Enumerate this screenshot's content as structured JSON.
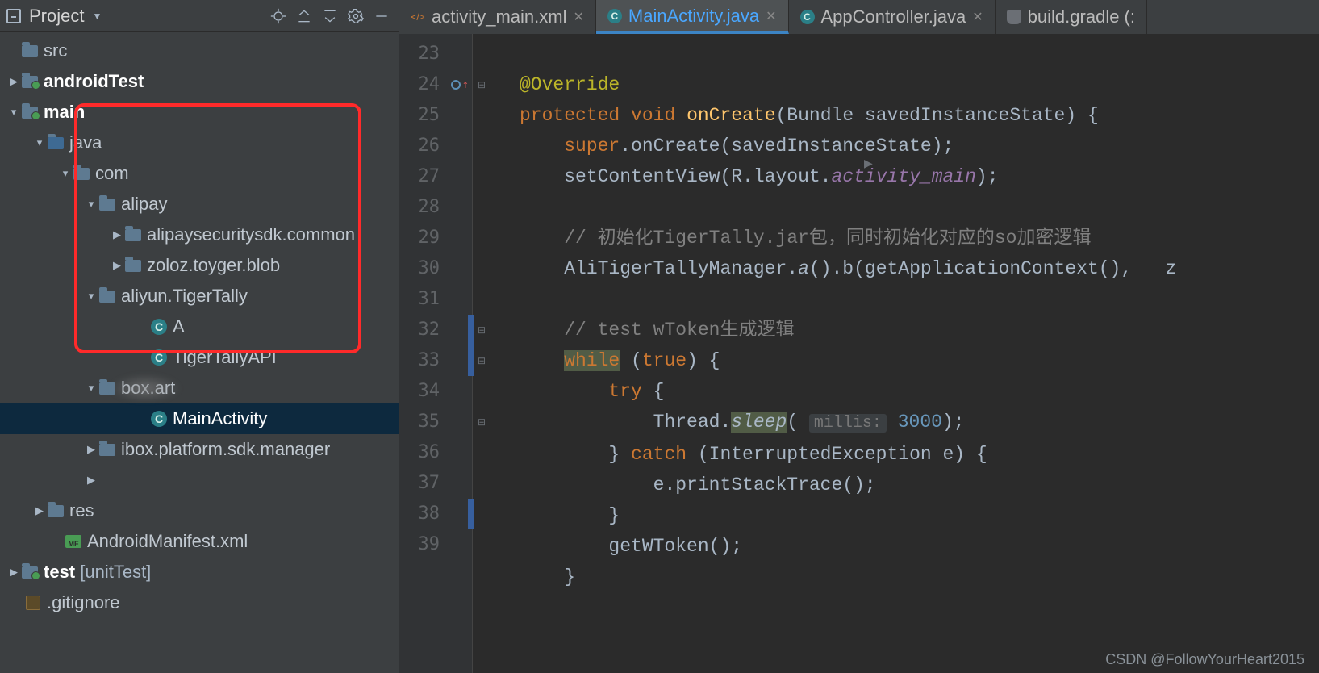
{
  "sidebar": {
    "title": "Project",
    "tree": {
      "src": "src",
      "androidTest": "androidTest",
      "main": "main",
      "java": "java",
      "com": "com",
      "alipay": "alipay",
      "alipaysecuritysdk": "alipaysecuritysdk.common",
      "zoloz": "zoloz.toyger.blob",
      "aliyun": "aliyun.TigerTally",
      "A": "A",
      "TigerTallyAPI": "TigerTallyAPI",
      "boxart": "box.art",
      "MainActivity": "MainActivity",
      "ibox": "ibox.platform.sdk.manager",
      "res": "res",
      "manifest": "AndroidManifest.xml",
      "test": "test",
      "unitTest": "[unitTest]",
      "gitignore": ".gitignore"
    }
  },
  "tabs": {
    "t0": "activity_main.xml",
    "t1": "MainActivity.java",
    "t2": "AppController.java",
    "t3": "build.gradle (:"
  },
  "lines": {
    "l23": "23",
    "l24": "24",
    "l25": "25",
    "l26": "26",
    "l27": "27",
    "l28": "28",
    "l29": "29",
    "l30": "30",
    "l31": "31",
    "l32": "32",
    "l33": "33",
    "l34": "34",
    "l35": "35",
    "l36": "36",
    "l37": "37",
    "l38": "38",
    "l39": "39"
  },
  "code": {
    "override": "@Override",
    "protected": "protected",
    "void": "void",
    "onCreate": "onCreate",
    "bundleSaved": "(Bundle savedInstanceState) {",
    "super": "super",
    "superCall": ".onCreate(savedInstanceState);",
    "setContentView": "setContentView(R.layout.",
    "activityMain": "activity_main",
    "closeParen": ");",
    "cmt1": "// 初始化TigerTally.jar包，同时初始化对应的so加密逻辑",
    "aliCall_a": "AliTigerTallyManager.",
    "aliCall_b": "a",
    "aliCall_c": "().b(getApplicationContext(),   z",
    "cmt2": "// test wToken生成逻辑",
    "while": "while",
    "true": "true",
    "whileOpen": " (",
    "whileClose": ") {",
    "try": "try",
    "tryOpen": " {",
    "threadDot": "Thread.",
    "sleep": "sleep",
    "sleepOpen": "(",
    "millisHint": "millis:",
    "sleepVal": "3000",
    "sleepClose": ");",
    "closeTry": "} ",
    "catch": "catch",
    "catchSig": " (InterruptedException e) {",
    "printStack": "e.printStackTrace();",
    "closeBrace": "}",
    "getWToken": "getWToken();"
  },
  "watermark": "CSDN @FollowYourHeart2015"
}
